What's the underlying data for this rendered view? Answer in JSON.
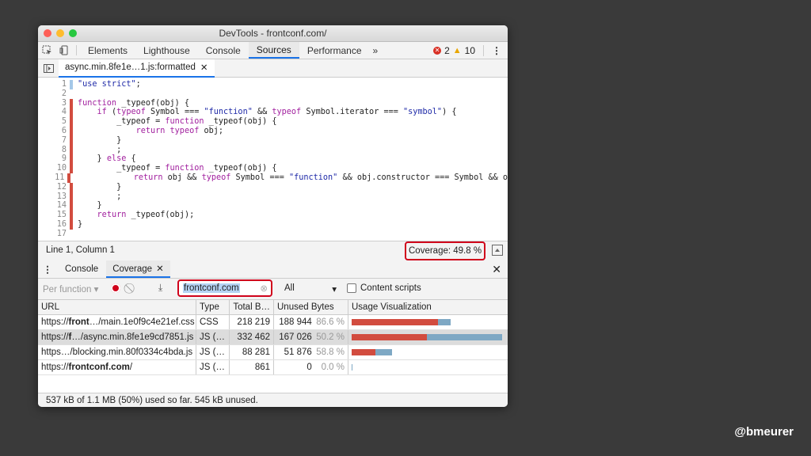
{
  "window": {
    "title": "DevTools - frontconf.com/"
  },
  "tabs": [
    "Elements",
    "Lighthouse",
    "Console",
    "Sources",
    "Performance",
    "»"
  ],
  "badges": {
    "errors": "2",
    "warnings": "10"
  },
  "file_tab": "async.min.8fe1e…1.js:formatted",
  "code_lines": [
    {
      "n": "1",
      "m": "blue",
      "t": [
        [
          "str",
          "\"use strict\""
        ],
        [
          "txt",
          ";"
        ]
      ]
    },
    {
      "n": "2",
      "m": "",
      "t": []
    },
    {
      "n": "3",
      "m": "red",
      "t": [
        [
          "kw",
          "function "
        ],
        [
          "txt",
          "_typeof(obj) {"
        ]
      ]
    },
    {
      "n": "4",
      "m": "red",
      "t": [
        [
          "txt",
          "    "
        ],
        [
          "kw",
          "if "
        ],
        [
          "txt",
          "("
        ],
        [
          "kw",
          "typeof "
        ],
        [
          "txt",
          "Symbol === "
        ],
        [
          "str",
          "\"function\""
        ],
        [
          "txt",
          " && "
        ],
        [
          "kw",
          "typeof "
        ],
        [
          "txt",
          "Symbol.iterator === "
        ],
        [
          "str",
          "\"symbol\""
        ],
        [
          "txt",
          ") {"
        ]
      ]
    },
    {
      "n": "5",
      "m": "red",
      "t": [
        [
          "txt",
          "        _typeof = "
        ],
        [
          "kw",
          "function "
        ],
        [
          "txt",
          "_typeof(obj) {"
        ]
      ]
    },
    {
      "n": "6",
      "m": "red",
      "t": [
        [
          "txt",
          "            "
        ],
        [
          "kw",
          "return typeof "
        ],
        [
          "txt",
          "obj;"
        ]
      ]
    },
    {
      "n": "7",
      "m": "red",
      "t": [
        [
          "txt",
          "        }"
        ]
      ]
    },
    {
      "n": "8",
      "m": "red",
      "t": [
        [
          "txt",
          "        ;"
        ]
      ]
    },
    {
      "n": "9",
      "m": "red",
      "t": [
        [
          "txt",
          "    } "
        ],
        [
          "kw",
          "else "
        ],
        [
          "txt",
          "{"
        ]
      ]
    },
    {
      "n": "10",
      "m": "red",
      "t": [
        [
          "txt",
          "        _typeof = "
        ],
        [
          "kw",
          "function "
        ],
        [
          "txt",
          "_typeof(obj) {"
        ]
      ]
    },
    {
      "n": "11",
      "m": "red",
      "t": [
        [
          "txt",
          "            "
        ],
        [
          "kw",
          "return "
        ],
        [
          "txt",
          "obj && "
        ],
        [
          "kw",
          "typeof "
        ],
        [
          "txt",
          "Symbol === "
        ],
        [
          "str",
          "\"function\""
        ],
        [
          "txt",
          " && obj.constructor === Symbol && o"
        ]
      ]
    },
    {
      "n": "12",
      "m": "red",
      "t": [
        [
          "txt",
          "        }"
        ]
      ]
    },
    {
      "n": "13",
      "m": "red",
      "t": [
        [
          "txt",
          "        ;"
        ]
      ]
    },
    {
      "n": "14",
      "m": "red",
      "t": [
        [
          "txt",
          "    }"
        ]
      ]
    },
    {
      "n": "15",
      "m": "red",
      "t": [
        [
          "txt",
          "    "
        ],
        [
          "kw",
          "return "
        ],
        [
          "txt",
          "_typeof(obj);"
        ]
      ]
    },
    {
      "n": "16",
      "m": "red",
      "t": [
        [
          "txt",
          "}"
        ]
      ]
    },
    {
      "n": "17",
      "m": "",
      "t": []
    }
  ],
  "status": {
    "position": "Line 1, Column 1",
    "coverage": "Coverage: 49.8 %"
  },
  "drawer": {
    "tabs": [
      "Console",
      "Coverage"
    ]
  },
  "toolbar": {
    "mode": "Per function",
    "filter_value": "frontconf.com",
    "type_value": "All",
    "content_scripts_label": "Content scripts"
  },
  "table": {
    "headers": [
      "URL",
      "Type",
      "Total B…",
      "Unused Bytes",
      "Usage Visualization"
    ],
    "rows": [
      {
        "url_pre": "https://",
        "url_bold": "front",
        "url_post": "…/main.1e0f9c4e21ef.css",
        "type": "CSS",
        "total": "218 219",
        "unused": "188 944",
        "pct": "86.6 %",
        "used_frac": 0.134,
        "total_frac": 0.66
      },
      {
        "url_pre": "https://",
        "url_bold": "f",
        "url_post": "…/async.min.8fe1e9cd7851.js",
        "type": "JS (…",
        "total": "332 462",
        "unused": "167 026",
        "pct": "50.2 %",
        "used_frac": 0.498,
        "total_frac": 1.0
      },
      {
        "url_pre": "https…/blocking.min.80f0334c4bda.js",
        "url_bold": "",
        "url_post": "",
        "type": "JS (…",
        "total": "88 281",
        "unused": "51 876",
        "pct": "58.8 %",
        "used_frac": 0.412,
        "total_frac": 0.266
      },
      {
        "url_pre": "https://",
        "url_bold": "frontconf.com",
        "url_post": "/",
        "type": "JS (…",
        "total": "861",
        "unused": "0",
        "pct": "0.0 %",
        "used_frac": 1.0,
        "total_frac": 0.003
      }
    ]
  },
  "footer": "537 kB of 1.1 MB (50%) used so far. 545 kB unused.",
  "handle": "@bmeurer",
  "colors": {
    "unused": "#d24c3f",
    "used": "#7ea8c4",
    "highlight": "#d0021b"
  }
}
